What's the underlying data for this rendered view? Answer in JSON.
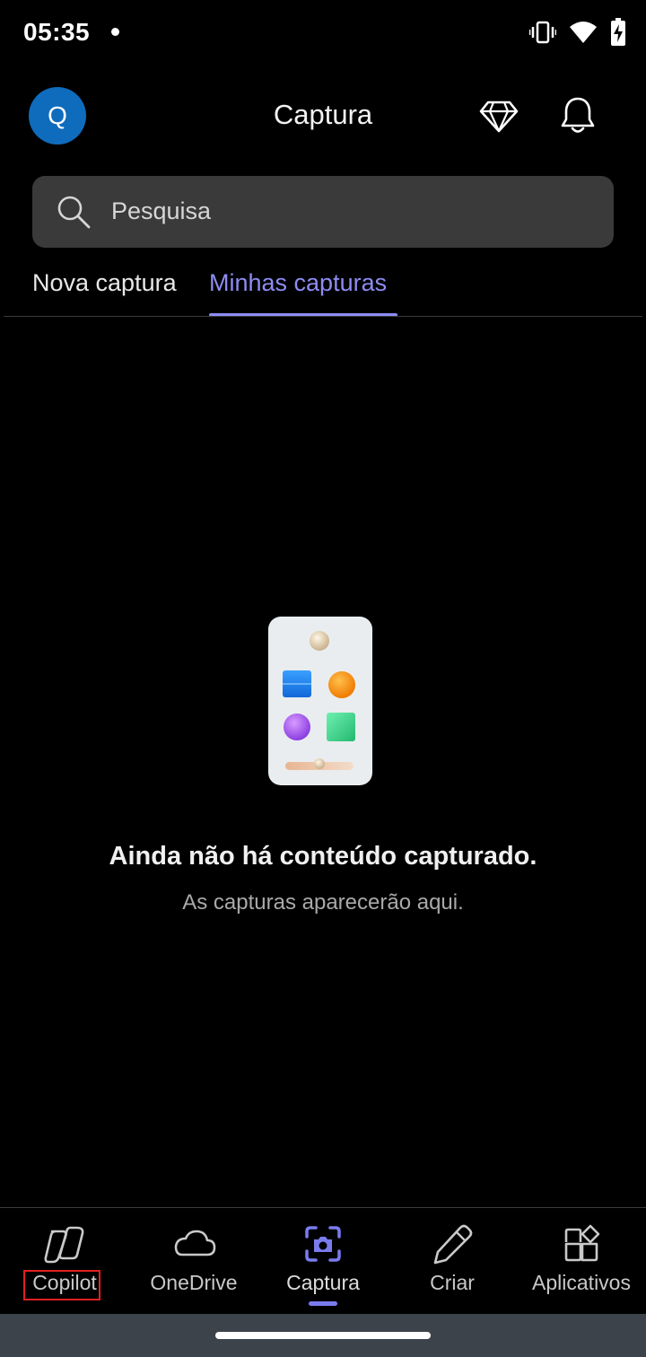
{
  "status_bar": {
    "time": "05:35",
    "icons": [
      "notification-dot",
      "vibrate-icon",
      "wifi-icon",
      "battery-charging-icon"
    ]
  },
  "header": {
    "avatar_initial": "Q",
    "title": "Captura",
    "icons": [
      "premium-diamond-icon",
      "notification-bell-icon"
    ]
  },
  "search": {
    "placeholder": "Pesquisa"
  },
  "tabs": [
    {
      "label": "Nova captura",
      "active": false
    },
    {
      "label": "Minhas capturas",
      "active": true
    }
  ],
  "empty_state": {
    "title": "Ainda não há conteúdo capturado.",
    "subtitle": "As capturas aparecerão aqui."
  },
  "bottom_nav": [
    {
      "label": "Copilot",
      "icon": "copilot-icon",
      "active": false
    },
    {
      "label": "OneDrive",
      "icon": "cloud-icon",
      "active": false
    },
    {
      "label": "Captura",
      "icon": "camera-capture-icon",
      "active": true
    },
    {
      "label": "Criar",
      "icon": "pen-icon",
      "active": false
    },
    {
      "label": "Aplicativos",
      "icon": "apps-icon",
      "active": false
    }
  ],
  "colors": {
    "accent": "#8e8cf3",
    "avatar": "#0f6cbd",
    "background": "#000000",
    "search_bg": "#3a3a3a"
  }
}
